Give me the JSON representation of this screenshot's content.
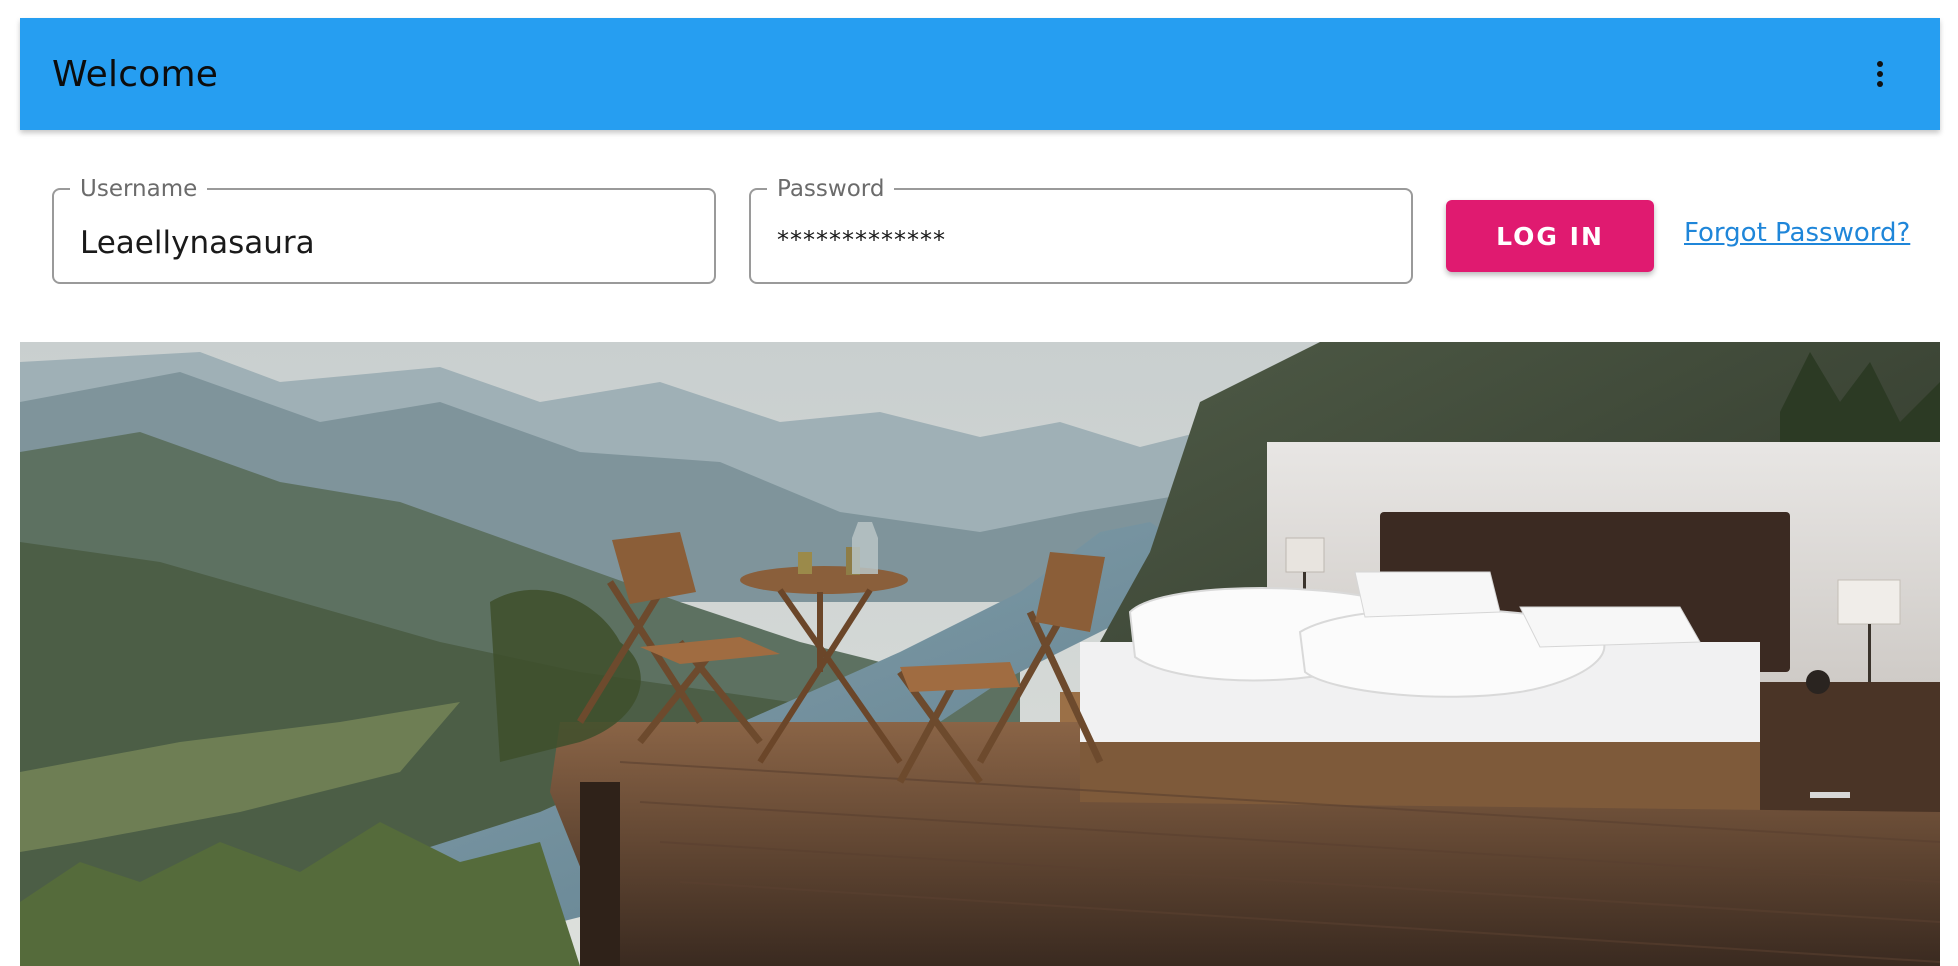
{
  "appbar": {
    "title": "Welcome",
    "menu_icon": "more-vert-icon"
  },
  "login": {
    "username_label": "Username",
    "username_value": "Leaellynasaura",
    "password_label": "Password",
    "password_value": "*************",
    "login_button": "LOG IN",
    "forgot_link": "Forgot Password?"
  },
  "colors": {
    "appbar": "#269ef1",
    "login_button": "#e01a70",
    "link": "#1f86d9"
  }
}
